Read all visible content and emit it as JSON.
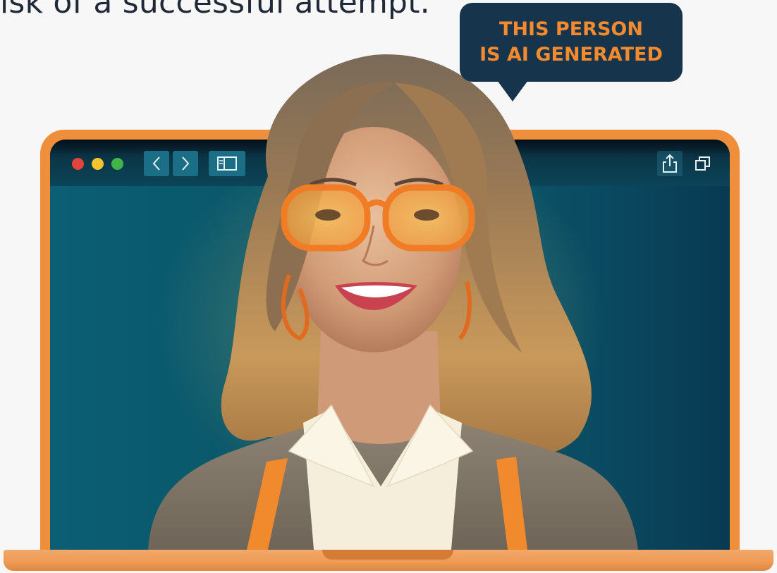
{
  "page": {
    "intro_text": "isk of a successful attempt."
  },
  "bubble": {
    "line1": "THIS PERSON",
    "line2": "IS AI GENERATED",
    "text_color": "#f38a2e",
    "background": "#16354c"
  },
  "browser": {
    "traffic_lights": [
      "#e0443a",
      "#f3c330",
      "#3fb54a"
    ],
    "buttons": [
      "chevron-left-icon",
      "chevron-right-icon",
      "sidebar-icon",
      "share-icon",
      "tabs-icon"
    ]
  },
  "colors": {
    "laptop_frame": "#ef8f3b",
    "screen_teal": "#0b5e74"
  }
}
